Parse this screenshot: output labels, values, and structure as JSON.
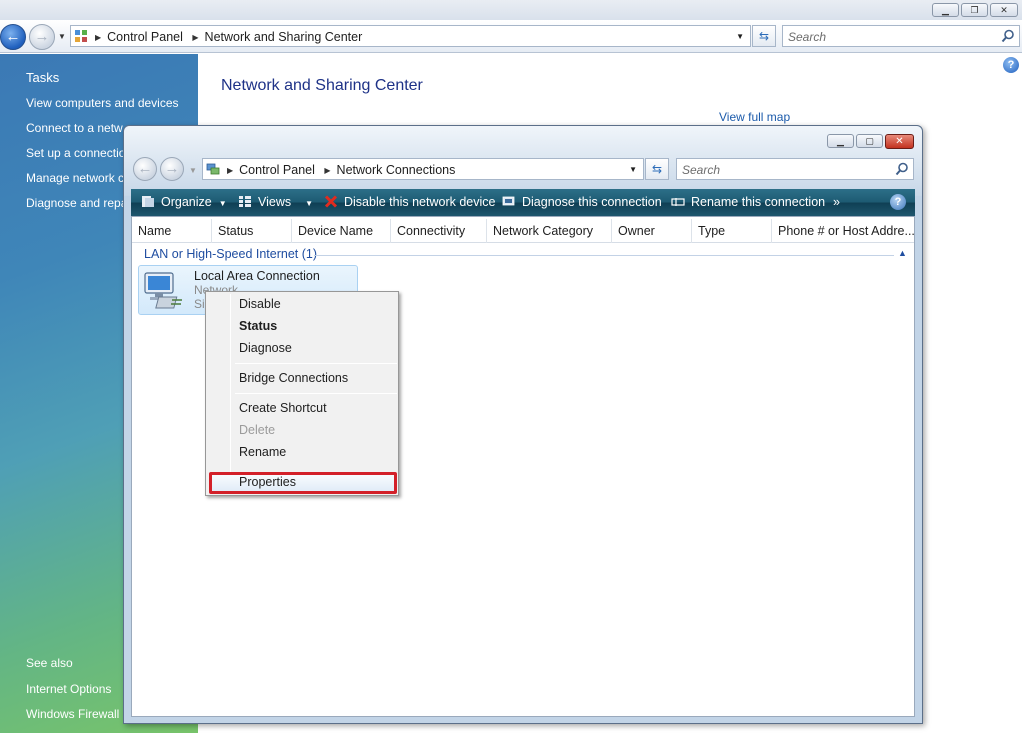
{
  "outer": {
    "breadcrumb": [
      "Control Panel",
      "Network and Sharing Center"
    ],
    "search_placeholder": "Search",
    "title": "Network and Sharing Center",
    "view_map": "View full map",
    "help": "?"
  },
  "tasks": {
    "heading": "Tasks",
    "items": [
      "View computers and devices",
      "Connect to a netw",
      "Set up a connectio",
      "Manage network c",
      "Diagnose and repa"
    ],
    "see_also_heading": "See also",
    "see_also": [
      "Internet Options",
      "Windows Firewall"
    ]
  },
  "inner": {
    "breadcrumb": [
      "Control Panel",
      "Network Connections"
    ],
    "search_placeholder": "Search",
    "toolbar": [
      "Organize",
      "Views",
      "Disable this network device",
      "Diagnose this connection",
      "Rename this connection"
    ],
    "more": "»",
    "help": "?",
    "columns": [
      "Name",
      "Status",
      "Device Name",
      "Connectivity",
      "Network Category",
      "Owner",
      "Type",
      "Phone # or Host Addre..."
    ],
    "group": "LAN or High-Speed Internet (1)",
    "connection": {
      "name": "Local Area Connection",
      "line2": "Network",
      "line3": "SiS"
    }
  },
  "context_menu": {
    "items": [
      "Disable",
      "Status",
      "Diagnose",
      "Bridge Connections",
      "Create Shortcut",
      "Delete",
      "Rename",
      "Properties"
    ]
  },
  "colors": {
    "highlight_box": "#d32029",
    "toolbar": "#1d5a72",
    "link": "#1c5bab"
  }
}
